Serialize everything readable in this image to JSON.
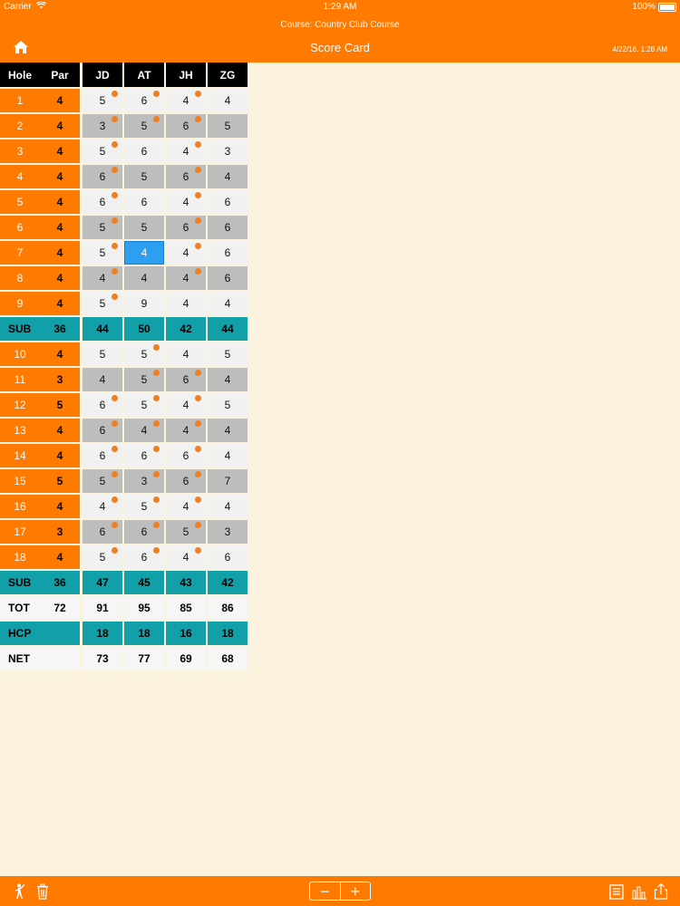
{
  "status_bar": {
    "carrier": "Carrier",
    "time": "1:29 AM",
    "battery": "100%"
  },
  "header": {
    "course": "Course: Country Club Course",
    "title": "Score Card",
    "datetime": "4/22/16, 1:28 AM"
  },
  "columns": {
    "hole": "Hole",
    "par": "Par",
    "players": [
      "JD",
      "AT",
      "JH",
      "ZG"
    ]
  },
  "holes_front": [
    {
      "hole": "1",
      "par": "4",
      "scores": [
        "5",
        "6",
        "4",
        "4"
      ],
      "dots": [
        true,
        true,
        true,
        false
      ]
    },
    {
      "hole": "2",
      "par": "4",
      "scores": [
        "3",
        "5",
        "6",
        "5"
      ],
      "dots": [
        true,
        true,
        true,
        false
      ]
    },
    {
      "hole": "3",
      "par": "4",
      "scores": [
        "5",
        "6",
        "4",
        "3"
      ],
      "dots": [
        true,
        false,
        true,
        false
      ]
    },
    {
      "hole": "4",
      "par": "4",
      "scores": [
        "6",
        "5",
        "6",
        "4"
      ],
      "dots": [
        true,
        false,
        true,
        false
      ]
    },
    {
      "hole": "5",
      "par": "4",
      "scores": [
        "6",
        "6",
        "4",
        "6"
      ],
      "dots": [
        true,
        false,
        true,
        false
      ]
    },
    {
      "hole": "6",
      "par": "4",
      "scores": [
        "5",
        "5",
        "6",
        "6"
      ],
      "dots": [
        true,
        false,
        true,
        false
      ]
    },
    {
      "hole": "7",
      "par": "4",
      "scores": [
        "5",
        "4",
        "4",
        "6"
      ],
      "dots": [
        true,
        false,
        true,
        false
      ]
    },
    {
      "hole": "8",
      "par": "4",
      "scores": [
        "4",
        "4",
        "4",
        "6"
      ],
      "dots": [
        true,
        false,
        true,
        false
      ]
    },
    {
      "hole": "9",
      "par": "4",
      "scores": [
        "5",
        "9",
        "4",
        "4"
      ],
      "dots": [
        true,
        false,
        false,
        false
      ]
    }
  ],
  "sub_front": {
    "label": "SUB",
    "par": "36",
    "values": [
      "44",
      "50",
      "42",
      "44"
    ]
  },
  "holes_back": [
    {
      "hole": "10",
      "par": "4",
      "scores": [
        "5",
        "5",
        "4",
        "5"
      ],
      "dots": [
        false,
        true,
        false,
        false
      ]
    },
    {
      "hole": "11",
      "par": "3",
      "scores": [
        "4",
        "5",
        "6",
        "4"
      ],
      "dots": [
        false,
        true,
        true,
        false
      ]
    },
    {
      "hole": "12",
      "par": "5",
      "scores": [
        "6",
        "5",
        "4",
        "5"
      ],
      "dots": [
        true,
        true,
        true,
        false
      ]
    },
    {
      "hole": "13",
      "par": "4",
      "scores": [
        "6",
        "4",
        "4",
        "4"
      ],
      "dots": [
        true,
        true,
        true,
        false
      ]
    },
    {
      "hole": "14",
      "par": "4",
      "scores": [
        "6",
        "6",
        "6",
        "4"
      ],
      "dots": [
        true,
        true,
        true,
        false
      ]
    },
    {
      "hole": "15",
      "par": "5",
      "scores": [
        "5",
        "3",
        "6",
        "7"
      ],
      "dots": [
        true,
        true,
        true,
        false
      ]
    },
    {
      "hole": "16",
      "par": "4",
      "scores": [
        "4",
        "5",
        "4",
        "4"
      ],
      "dots": [
        true,
        true,
        true,
        false
      ]
    },
    {
      "hole": "17",
      "par": "3",
      "scores": [
        "6",
        "6",
        "5",
        "3"
      ],
      "dots": [
        true,
        true,
        true,
        false
      ]
    },
    {
      "hole": "18",
      "par": "4",
      "scores": [
        "5",
        "6",
        "4",
        "6"
      ],
      "dots": [
        true,
        true,
        true,
        false
      ]
    }
  ],
  "sub_back": {
    "label": "SUB",
    "par": "36",
    "values": [
      "47",
      "45",
      "43",
      "42"
    ]
  },
  "total": {
    "label": "TOT",
    "par": "72",
    "values": [
      "91",
      "95",
      "85",
      "86"
    ]
  },
  "handicap": {
    "label": "HCP",
    "par": "",
    "values": [
      "18",
      "18",
      "16",
      "18"
    ]
  },
  "net": {
    "label": "NET",
    "par": "",
    "values": [
      "73",
      "77",
      "69",
      "68"
    ]
  },
  "selected_cell": {
    "hole": "7",
    "player": "AT"
  },
  "colors": {
    "accent": "#ff7a00",
    "subtotal": "#11a0a8",
    "selected": "#2e9ef0",
    "dot": "#f07f1f",
    "background": "#fbf3dd"
  },
  "footer": {
    "icons": [
      "golfer-icon",
      "trash-icon",
      "minus-icon",
      "plus-icon",
      "list-icon",
      "chart-icon",
      "share-icon"
    ],
    "minus_label": "−",
    "plus_label": "+"
  }
}
